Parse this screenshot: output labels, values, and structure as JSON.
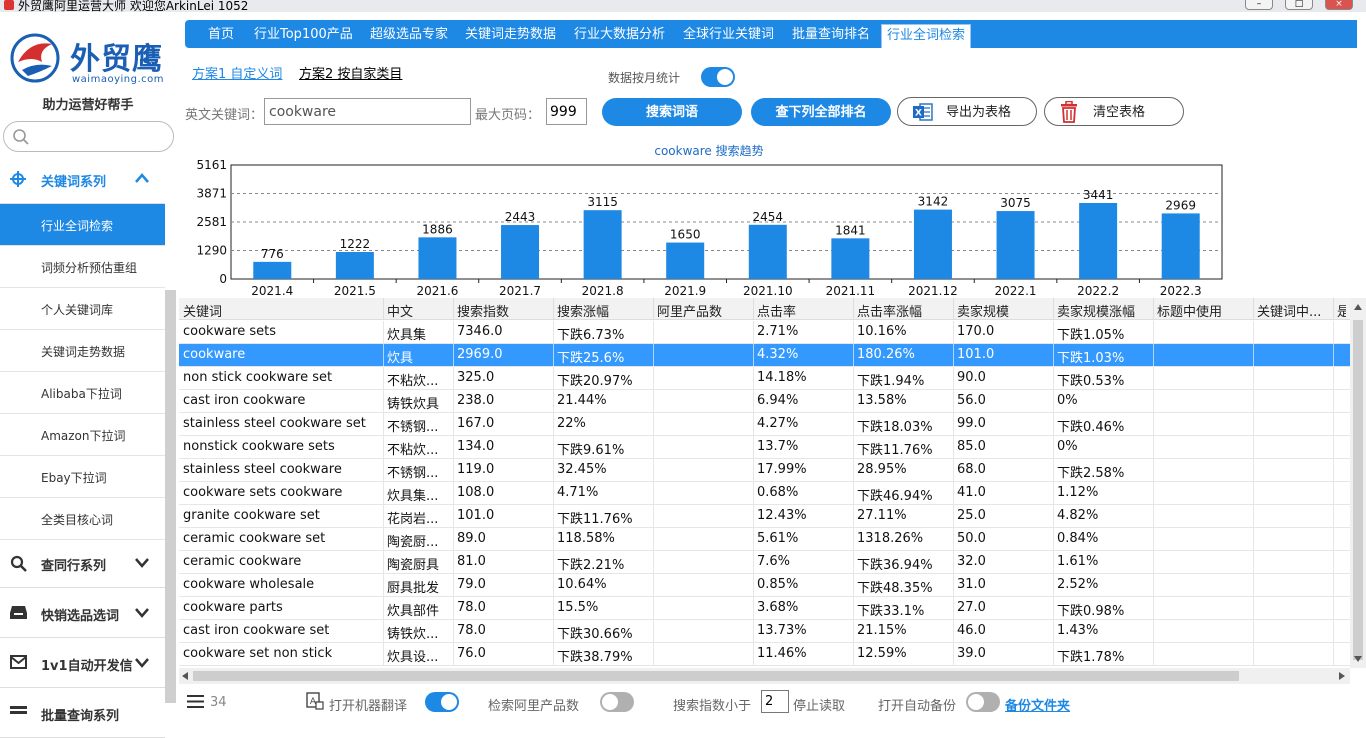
{
  "window": {
    "title": "外贸鹰阿里运营大师 欢迎您ArkinLei 1052"
  },
  "logo": {
    "name": "外贸鹰",
    "domain": "waimaoying.com",
    "slogan": "助力运营好帮手"
  },
  "sidebar": {
    "search_placeholder": "",
    "groups": [
      {
        "label": "关键词系列",
        "icon": "crosshair-icon",
        "expanded": true
      },
      {
        "label": "查同行系列",
        "icon": "search-icon",
        "expanded": false
      },
      {
        "label": "快销选品选词",
        "icon": "inbox-icon",
        "expanded": false
      },
      {
        "label": "1v1自动开发信",
        "icon": "mail-icon",
        "expanded": false
      },
      {
        "label": "批量查询系列",
        "icon": "list-icon",
        "expanded": false
      }
    ],
    "items": [
      {
        "label": "行业全词检索",
        "active": true
      },
      {
        "label": "词频分析预估重组"
      },
      {
        "label": "个人关键词库"
      },
      {
        "label": "关键词走势数据"
      },
      {
        "label": "Alibaba下拉词"
      },
      {
        "label": "Amazon下拉词"
      },
      {
        "label": "Ebay下拉词"
      },
      {
        "label": "全类目核心词"
      }
    ]
  },
  "topnav": {
    "tabs": [
      "首页",
      "行业Top100产品",
      "超级选品专家",
      "关键词走势数据",
      "行业大数据分析",
      "全球行业关键词",
      "批量查询排名",
      "行业全词检索"
    ],
    "active_index": 7
  },
  "plans": {
    "plan1": "方案1 自定义词",
    "plan2": "方案2 按自家类目"
  },
  "monthly": {
    "label": "数据按月统计",
    "on": true
  },
  "search": {
    "keyword_label": "英文关键词：",
    "keyword_value": "cookware",
    "max_page_label": "最大页码：",
    "max_page_value": "999",
    "search_button": "搜索词语",
    "rank_button": "查下列全部排名",
    "export_button": "导出为表格",
    "clear_button": "清空表格"
  },
  "chart_data": {
    "type": "bar",
    "title": "cookware 搜索趋势",
    "categories": [
      "2021.4",
      "2021.5",
      "2021.6",
      "2021.7",
      "2021.8",
      "2021.9",
      "2021.10",
      "2021.11",
      "2021.12",
      "2022.1",
      "2022.2",
      "2022.3"
    ],
    "values": [
      776,
      1222,
      1886,
      2443,
      3115,
      1650,
      2454,
      1841,
      3142,
      3075,
      3441,
      2969
    ],
    "ylim": [
      0,
      5161
    ],
    "yticks": [
      "0",
      "1290",
      "2581",
      "3871",
      "5161"
    ],
    "grid": true,
    "color": "#1e88e5"
  },
  "table": {
    "columns": [
      "关键词",
      "中文",
      "搜索指数",
      "搜索涨幅",
      "阿里产品数",
      "点击率",
      "点击率涨幅",
      "卖家规模",
      "卖家规模涨幅",
      "标题中使用",
      "关键词中...",
      "是"
    ],
    "selected_row": 1,
    "rows": [
      [
        "cookware sets",
        "炊具集",
        "7346.0",
        "下跌6.73%",
        "",
        "2.71%",
        "10.16%",
        "170.0",
        "下跌1.05%",
        "",
        ""
      ],
      [
        "cookware",
        "炊具",
        "2969.0",
        "下跌25.6%",
        "",
        "4.32%",
        "180.26%",
        "101.0",
        "下跌1.03%",
        "",
        ""
      ],
      [
        "non stick cookware set",
        "不粘炊...",
        "325.0",
        "下跌20.97%",
        "",
        "14.18%",
        "下跌1.94%",
        "90.0",
        "下跌0.53%",
        "",
        ""
      ],
      [
        "cast iron cookware",
        "铸铁炊具",
        "238.0",
        "21.44%",
        "",
        "6.94%",
        "13.58%",
        "56.0",
        "0%",
        "",
        ""
      ],
      [
        "stainless steel cookware set",
        "不锈钢...",
        "167.0",
        "22%",
        "",
        "4.27%",
        "下跌18.03%",
        "99.0",
        "下跌0.46%",
        "",
        ""
      ],
      [
        "nonstick cookware sets",
        "不粘炊...",
        "134.0",
        "下跌9.61%",
        "",
        "13.7%",
        "下跌11.76%",
        "85.0",
        "0%",
        "",
        ""
      ],
      [
        "stainless steel cookware",
        "不锈钢...",
        "119.0",
        "32.45%",
        "",
        "17.99%",
        "28.95%",
        "68.0",
        "下跌2.58%",
        "",
        ""
      ],
      [
        "cookware sets cookware",
        "炊具集...",
        "108.0",
        "4.71%",
        "",
        "0.68%",
        "下跌46.94%",
        "41.0",
        "1.12%",
        "",
        ""
      ],
      [
        "granite cookware set",
        "花岗岩...",
        "101.0",
        "下跌11.76%",
        "",
        "12.43%",
        "27.11%",
        "25.0",
        "4.82%",
        "",
        ""
      ],
      [
        "ceramic cookware set",
        "陶瓷厨...",
        "89.0",
        "118.58%",
        "",
        "5.61%",
        "1318.26%",
        "50.0",
        "0.84%",
        "",
        ""
      ],
      [
        "ceramic cookware",
        "陶瓷厨具",
        "81.0",
        "下跌2.21%",
        "",
        "7.6%",
        "下跌36.94%",
        "32.0",
        "1.61%",
        "",
        ""
      ],
      [
        "cookware wholesale",
        "厨具批发",
        "79.0",
        "10.64%",
        "",
        "0.85%",
        "下跌48.35%",
        "31.0",
        "2.52%",
        "",
        ""
      ],
      [
        "cookware parts",
        "炊具部件",
        "78.0",
        "15.5%",
        "",
        "3.68%",
        "下跌33.1%",
        "27.0",
        "下跌0.98%",
        "",
        ""
      ],
      [
        "cast iron cookware set",
        "铸铁炊...",
        "78.0",
        "下跌30.66%",
        "",
        "13.73%",
        "21.15%",
        "46.0",
        "1.43%",
        "",
        ""
      ],
      [
        "cookware set non stick",
        "炊具设...",
        "76.0",
        "下跌38.79%",
        "",
        "11.46%",
        "12.59%",
        "39.0",
        "下跌1.78%",
        "",
        ""
      ]
    ]
  },
  "statusbar": {
    "count": "34",
    "translate_label": "打开机器翻译",
    "translate_on": true,
    "ali_count_label": "检索阿里产品数",
    "ali_count_on": false,
    "threshold_label": "搜索指数小于",
    "threshold_value": "2",
    "stop_label": "停止读取",
    "auto_backup_label": "打开自动备份",
    "auto_backup_on": false,
    "backup_folder_link": "备份文件夹"
  }
}
